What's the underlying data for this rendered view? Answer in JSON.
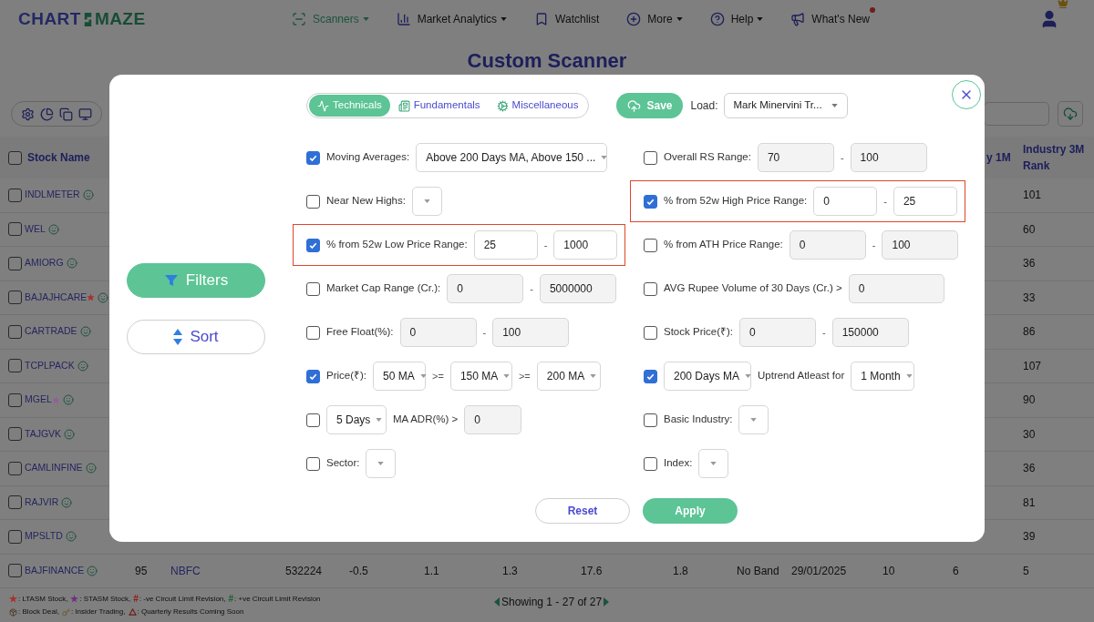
{
  "header": {
    "logo": [
      "CHART",
      "MAZE"
    ],
    "nav": [
      {
        "label": "Scanners",
        "selected": true,
        "dropdown": true,
        "badge": false
      },
      {
        "label": "Market Analytics",
        "selected": false,
        "dropdown": true,
        "badge": false
      },
      {
        "label": "Watchlist",
        "selected": false,
        "dropdown": false,
        "badge": false
      },
      {
        "label": "More",
        "selected": false,
        "dropdown": true,
        "badge": false
      },
      {
        "label": "Help",
        "selected": false,
        "dropdown": true,
        "badge": false
      },
      {
        "label": "What's New",
        "selected": false,
        "dropdown": false,
        "badge": true
      }
    ]
  },
  "page_title": "Custom Scanner",
  "table": {
    "header_checked": false,
    "columns": [
      "Stock Name",
      "y 1M",
      "Industry 3M Rank"
    ],
    "rows": [
      {
        "name": "INDLMETER",
        "checked": false,
        "rank": "101"
      },
      {
        "name": "WEL",
        "checked": false,
        "rank": "60"
      },
      {
        "name": "AMIORG",
        "checked": false,
        "rank": "36"
      },
      {
        "name": "BAJAJHCARE",
        "checked": false,
        "star": {
          "color": "#a8302a"
        },
        "rank": "33"
      },
      {
        "name": "CARTRADE",
        "checked": false,
        "rank": "86"
      },
      {
        "name": "TCPLPACK",
        "checked": false,
        "rank": "107"
      },
      {
        "name": "MGEL",
        "checked": false,
        "star": {
          "color": "#935ca0"
        },
        "rank": "90"
      },
      {
        "name": "TAJGVK",
        "checked": false,
        "rank": "30"
      },
      {
        "name": "CAMLINFINE",
        "checked": false,
        "rank": "36"
      },
      {
        "name": "RAJVIR",
        "checked": false,
        "rank": "81"
      },
      {
        "name": "MPSLTD",
        "checked": false,
        "rank": "39"
      },
      {
        "name": "BAJFINANCE",
        "checked": false,
        "cells": [
          "95",
          "NBFC",
          "532224",
          "-0.5",
          "1.1",
          "1.3",
          "17.6",
          "1.8",
          "No Band",
          "29/01/2025",
          "10",
          "6"
        ],
        "rank": "5"
      }
    ]
  },
  "legend": [
    [
      {
        "kind": "symbol",
        "symbol": "★",
        "color": "#a8302a",
        "label": ": LTASM Stock,"
      },
      {
        "kind": "symbol",
        "symbol": "★",
        "color": "#6e2f80",
        "label": ": STASM Stock,"
      },
      {
        "kind": "symbol",
        "symbol": "#",
        "color": "#8e1d17",
        "label": ": -ve Circuit Limit Revision,"
      },
      {
        "kind": "symbol",
        "symbol": "#",
        "color": "#1f6030",
        "label": ": +ve Circuit Limit Revision"
      }
    ],
    [
      {
        "kind": "box",
        "label": ": Block Deal,"
      },
      {
        "kind": "key",
        "label": ": Insider Trading,"
      },
      {
        "kind": "triangle",
        "label": ": Quarterly Results Coming Soon"
      }
    ]
  ],
  "pagination": "Showing 1 - 27 of 27",
  "modal": {
    "tabs": [
      {
        "label": "Technicals",
        "selected": true
      },
      {
        "label": "Fundamentals",
        "selected": false
      },
      {
        "label": "Miscellaneous",
        "selected": false
      }
    ],
    "save": "Save",
    "load_label": "Load:",
    "load_value": "Mark Minervini Tr...",
    "side_buttons": [
      {
        "label": "Filters",
        "selected": true
      },
      {
        "label": "Sort",
        "selected": false
      }
    ],
    "left_filters": [
      {
        "kind": "select",
        "checked": true,
        "highlighted": false,
        "label": "Moving Averages:",
        "value": "Above 200 Days MA, Above 150 ..."
      },
      {
        "kind": "select",
        "checked": false,
        "highlighted": false,
        "label": "Near New Highs:"
      },
      {
        "kind": "range",
        "checked": true,
        "highlighted": true,
        "label": "% from 52w Low Price Range:",
        "min": "25",
        "separator": "-",
        "max": "1000"
      },
      {
        "kind": "range",
        "checked": false,
        "highlighted": false,
        "label": "Market Cap Range (Cr.):",
        "min": "0",
        "separator": "-",
        "max": "5000000"
      },
      {
        "kind": "range",
        "checked": false,
        "highlighted": false,
        "label": "Free Float(%):",
        "min": "0",
        "separator": "-",
        "max": "100"
      },
      {
        "kind": "price_ma",
        "checked": true,
        "highlighted": false,
        "label": "Price(₹):",
        "selects": [
          "50 MA",
          "150 MA",
          "200 MA"
        ],
        "operators": [
          ">=",
          ">="
        ]
      },
      {
        "kind": "adr",
        "checked": false,
        "highlighted": false,
        "select": "5 Days",
        "label": "MA ADR(%) >",
        "value": "0"
      },
      {
        "kind": "select",
        "checked": false,
        "highlighted": false,
        "label": "Sector:"
      }
    ],
    "right_filters": [
      {
        "kind": "range",
        "checked": false,
        "highlighted": false,
        "label": "Overall RS Range:",
        "min": "70",
        "separator": "-",
        "max": "100"
      },
      {
        "kind": "range",
        "checked": true,
        "highlighted": true,
        "label": "% from 52w High Price Range:",
        "min": "0",
        "separator": "-",
        "max": "25"
      },
      {
        "kind": "range",
        "checked": false,
        "highlighted": false,
        "label": "% from ATH Price Range:",
        "min": "0",
        "separator": "-",
        "max": "100"
      },
      {
        "kind": "single",
        "checked": false,
        "highlighted": false,
        "label": "AVG Rupee Volume of 30 Days (Cr.) >",
        "value": "0"
      },
      {
        "kind": "range",
        "checked": false,
        "highlighted": false,
        "label": "Stock Price(₹):",
        "min": "0",
        "separator": "-",
        "max": "150000"
      },
      {
        "kind": "uptrend",
        "checked": true,
        "highlighted": false,
        "select": "200 Days MA",
        "label": "Uptrend Atleast for",
        "select_2": "1 Month"
      },
      {
        "kind": "select",
        "checked": false,
        "highlighted": false,
        "label": "Basic Industry:"
      },
      {
        "kind": "select",
        "checked": false,
        "highlighted": false,
        "label": "Index:"
      }
    ],
    "reset": "Reset",
    "apply": "Apply"
  }
}
